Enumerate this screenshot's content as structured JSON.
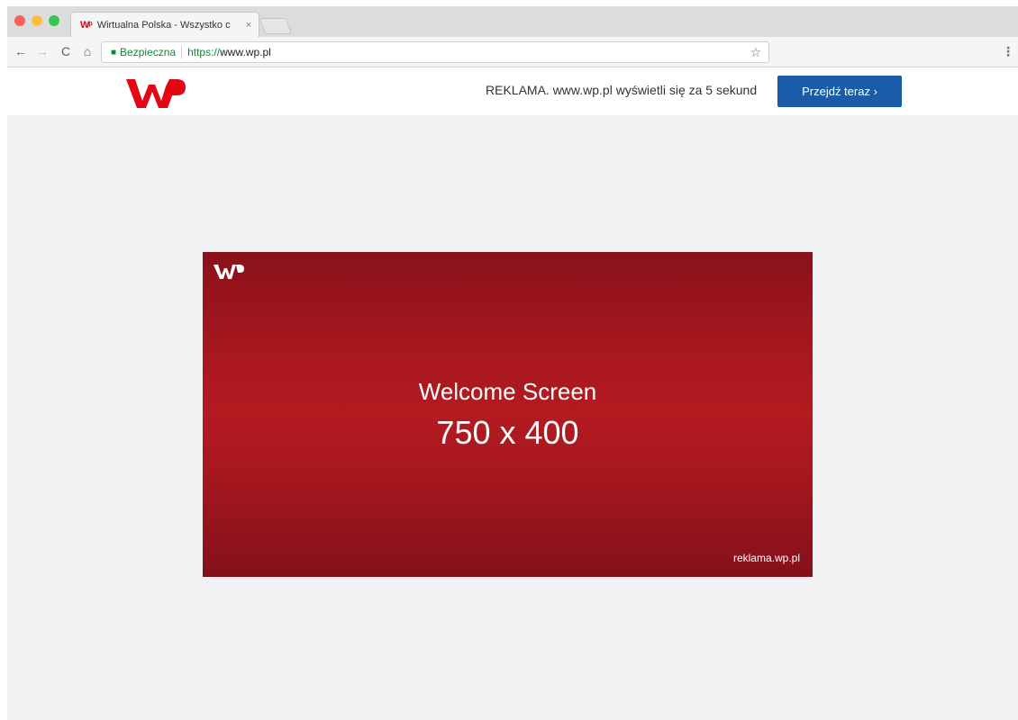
{
  "browser": {
    "tab": {
      "favicon": "wp-logo",
      "title": "Wirtualna Polska - Wszystko c",
      "close": "×"
    },
    "toolbar": {
      "back": "←",
      "forward": "→",
      "reload": "C",
      "home": "⌂",
      "security_label": "Bezpieczna",
      "url_scheme": "https://",
      "url_host": "www.wp.pl",
      "bookmark": "☆",
      "menu": "⋮"
    }
  },
  "page": {
    "adbar": {
      "logo": "wp-logo",
      "notice": "REKLAMA. www.wp.pl wyświetli się za 5 sekund",
      "cta_label": "Przejdź teraz ›"
    },
    "banner": {
      "title": "Welcome Screen",
      "size": "750 x 400",
      "url": "reklama.wp.pl",
      "colors": {
        "dark": "#8a111a",
        "mid": "#b31b21"
      }
    },
    "colors": {
      "brand_red": "#e30613",
      "cta_blue": "#1a5ca8",
      "page_bg": "#f2f1f3"
    }
  }
}
